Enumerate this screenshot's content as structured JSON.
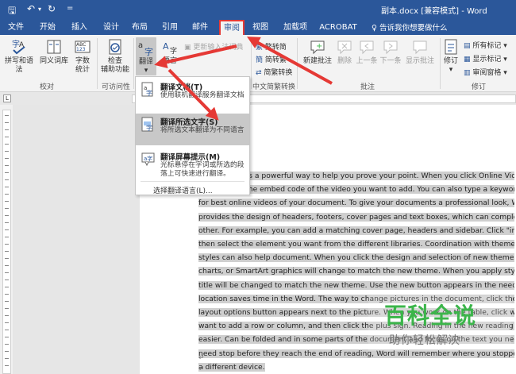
{
  "titlebar": {
    "save_glyph": "🖫",
    "undo_glyph": "↶",
    "undo_dropdown": "▾",
    "redo_glyph": "↻",
    "customize_glyph": "=",
    "title": "副本.docx [兼容模式] - Word"
  },
  "tabs": [
    "文件",
    "开始",
    "插入",
    "设计",
    "布局",
    "引用",
    "邮件",
    "审阅",
    "视图",
    "加载项",
    "ACROBAT"
  ],
  "active_tab": "审阅",
  "tell_me": "告诉我你想要做什么",
  "ribbon": {
    "proofing": {
      "spelling": "拼写和语法",
      "thesaurus": "同义词库",
      "wordcount_line1": "字数",
      "wordcount_line2": "统计",
      "label": "校对"
    },
    "accessibility": {
      "check_line1": "检查",
      "check_line2": "辅助功能",
      "label": "可访问性"
    },
    "language": {
      "translate": "翻译",
      "language": "语言",
      "update_ime": "更新输入法词典"
    },
    "chinese": {
      "trad_to_simp": "繁转简",
      "simp_to_trad": "简转繁",
      "convert": "简繁转换",
      "label": "中文简繁转换"
    },
    "comments": {
      "new": "新建批注",
      "delete": "删除",
      "prev": "上一条",
      "next": "下一条",
      "show": "显示批注",
      "label": "批注"
    },
    "tracking": {
      "track": "修订",
      "all_markup": "所有标记",
      "show_markup": "显示标记",
      "pane": "审阅窗格",
      "label": "修订"
    }
  },
  "menu": {
    "items": [
      {
        "title": "翻译文档(T)",
        "desc": "使用联机翻译服务翻译文档"
      },
      {
        "title": "翻译所选文字(S)",
        "desc": "将所选文本翻译为不同语言"
      },
      {
        "title": "翻译屏幕提示(M)",
        "desc": "光标悬停在字词或所选的段落上可快速进行翻译。"
      }
    ],
    "choose_language": "选择翻译语言(L)..."
  },
  "document": {
    "lines": [
      "Video provides a powerful way to help you prove your point. When you click Online Video, you",
      "can paste in the embed code of the video you want to add. You can also type a keyword to search",
      "for best online videos of your document. To give your documents a professional look, Word",
      "provides the design of headers, footers, cover pages and text boxes, which can complement each",
      "other. For example, you can add a matching cover page, headers and sidebar. Click \"insert\" and",
      "then select the element you want from the different libraries. Coordination with themes and",
      "styles can also help document. When you click the design and selection of new themes, pictures,",
      "charts, or SmartArt graphics will change to match the new theme. When you apply styles, your",
      "title will be changed to match the new theme. Use the new button appears in the needed",
      "location saves time in the Word. The way to change pictures in the document, click the picture,",
      "layout options button appears next to the picture. When you work on the table, click where you",
      "want to add a row or column, and then click the plus sign. Reading in the new reading view is much",
      "easier. Can be folded and in some parts of the document and focus on the text you need. If you",
      "need stop before they reach the end of reading, Word will remember where you stopped - even on",
      "a different device."
    ],
    "para_mark": "↵",
    "ruler_marker": "L"
  },
  "watermark": {
    "big": "百科全说",
    "small": "助你轻松解决"
  },
  "colors": {
    "accent": "#2b579a",
    "arrow": "#e53935",
    "watermark_green": "#3bb54a"
  }
}
